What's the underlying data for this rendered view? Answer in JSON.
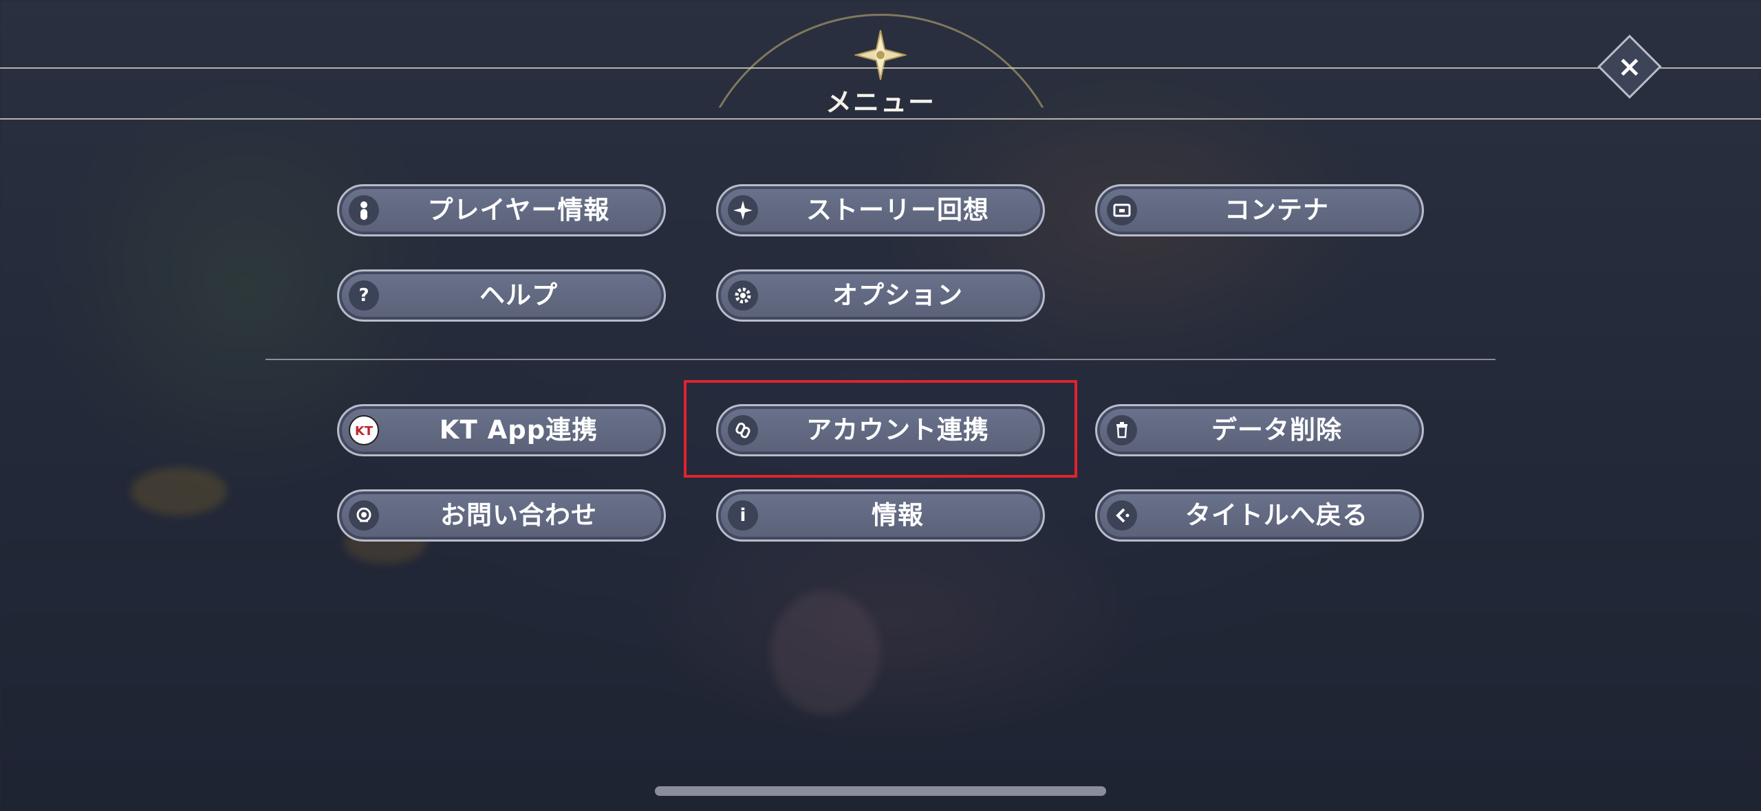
{
  "header": {
    "title": "メニュー",
    "close_icon": "×"
  },
  "menu": {
    "player_info": "プレイヤー情報",
    "story_recall": "ストーリー回想",
    "container": "コンテナ",
    "help": "ヘルプ",
    "options": "オプション",
    "kt_app": "KT App連携",
    "account_link": "アカウント連携",
    "delete_data": "データ削除",
    "contact": "お問い合わせ",
    "info": "情報",
    "back_to_title": "タイトルへ戻る"
  },
  "icons": {
    "player": "person-icon",
    "story": "sparkle-icon",
    "container": "chest-icon",
    "help": "?",
    "options": "gear-icon",
    "kt": "KT",
    "account": "link-icon",
    "delete": "trash-icon",
    "contact": "headset-icon",
    "info": "i",
    "back": "back-arrow-icon"
  },
  "colors": {
    "button_fill": "#5f667e",
    "button_border": "#b8bccb",
    "highlight": "#e0232d",
    "accent_gold": "#c8b478"
  }
}
